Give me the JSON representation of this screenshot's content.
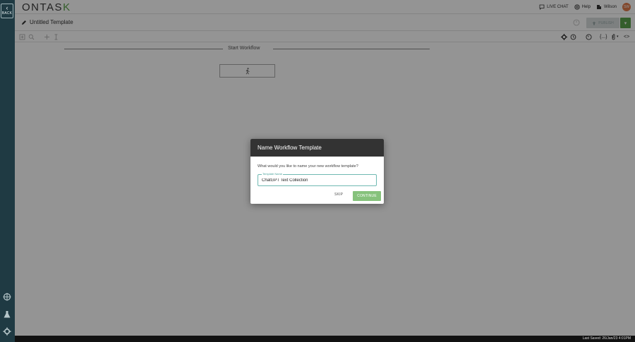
{
  "rail": {
    "back_label": "BACK",
    "icons": [
      "crosshair-icon",
      "flask-icon",
      "gear-icon"
    ]
  },
  "brand": {
    "logo_main": "ONTAS",
    "logo_accent": "K",
    "accent_color": "#5aa34c",
    "rail_color": "#1f3a43"
  },
  "header": {
    "live_chat": "LIVE CHAT",
    "help": "Help",
    "user_name": "Wilson",
    "avatar_initials": "SW"
  },
  "titlebar": {
    "template_title": "Untitled Template",
    "publish_label": "PUBLISH",
    "caret": "▾"
  },
  "toolbar": {
    "right_braces": "{...}",
    "right_code": "<>"
  },
  "canvas": {
    "start_workflow": "Start Workflow"
  },
  "modal": {
    "title": "Name Workflow Template",
    "question": "What would you like to name your new workflow template?",
    "field_label": "Template Name",
    "field_value": "ChatGPT Text Collection",
    "skip_label": "SKIP",
    "continue_label": "CONTINUE",
    "continue_color": "#86c27c"
  },
  "status": {
    "last_saved": "Last Saved: 26/Jan/23 4:01PM"
  }
}
